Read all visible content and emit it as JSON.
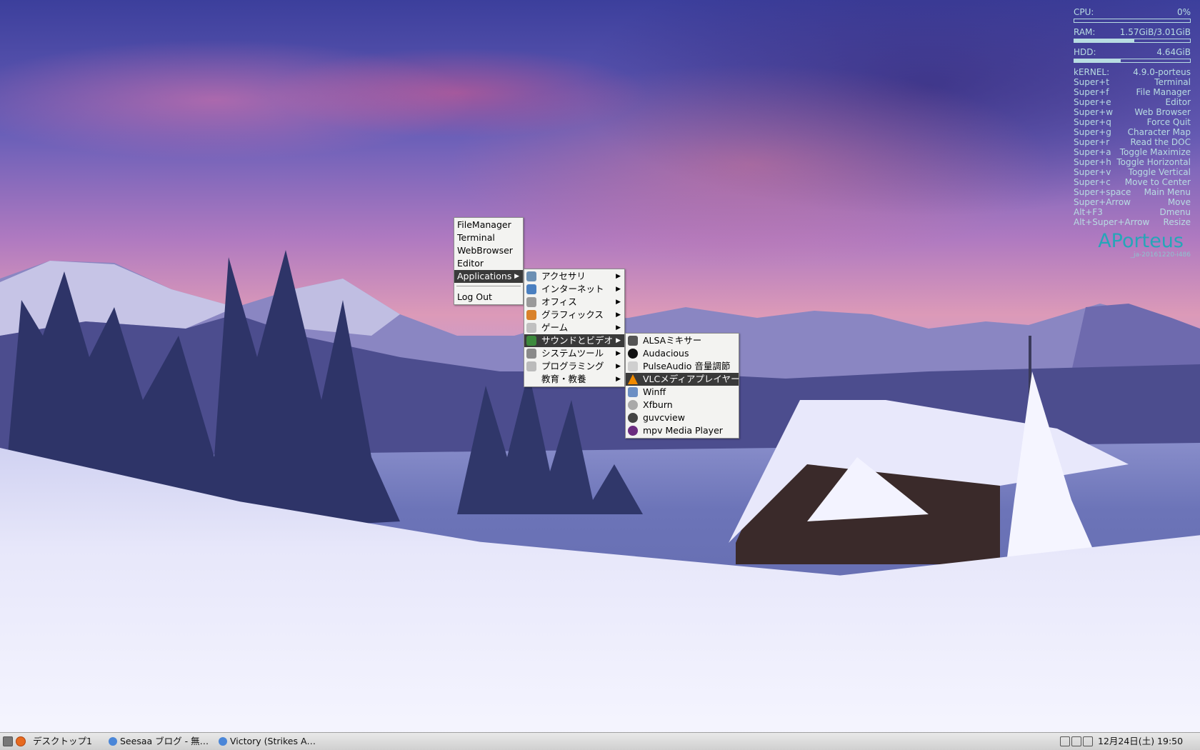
{
  "system_monitor": {
    "cpu_label": "CPU:",
    "cpu_value": "0%",
    "cpu_fraction": 0.0,
    "ram_label": "RAM:",
    "ram_value": "1.57GiB/3.01GiB",
    "ram_fraction": 0.52,
    "hdd_label": "HDD:",
    "hdd_value": "4.64GiB",
    "hdd_fraction": 0.4,
    "kernel_label": "kERNEL:",
    "kernel_value": "4.9.0-porteus",
    "shortcuts": [
      {
        "key": "Super+t",
        "action": "Terminal"
      },
      {
        "key": "Super+f",
        "action": "File Manager"
      },
      {
        "key": "Super+e",
        "action": "Editor"
      },
      {
        "key": "Super+w",
        "action": "Web Browser"
      },
      {
        "key": "Super+q",
        "action": "Force Quit"
      },
      {
        "key": "Super+g",
        "action": "Character Map"
      },
      {
        "key": "Super+r",
        "action": "Read the DOC"
      },
      {
        "key": "Super+a",
        "action": "Toggle Maximize"
      },
      {
        "key": "Super+h",
        "action": "Toggle Horizontal"
      },
      {
        "key": "Super+v",
        "action": "Toggle Vertical"
      },
      {
        "key": "Super+c",
        "action": "Move to Center"
      },
      {
        "key": "Super+space",
        "action": "Main Menu"
      },
      {
        "key": "Super+Arrow",
        "action": "Move"
      },
      {
        "key": "Alt+F3",
        "action": "Dmenu"
      },
      {
        "key": "Alt+Super+Arrow",
        "action": "Resize"
      }
    ],
    "brand": "APorteus",
    "version": "_ja-20161220-i486"
  },
  "root_menu": {
    "items": [
      "FileManager",
      "Terminal",
      "WebBrowser",
      "Editor",
      "Applications"
    ],
    "logout": "Log Out"
  },
  "applications_menu": {
    "items": [
      {
        "label": "アクセサリ",
        "icon": "accessories-icon",
        "color": "#6b8fb3"
      },
      {
        "label": "インターネット",
        "icon": "globe-icon",
        "color": "#4a7fc0"
      },
      {
        "label": "オフィス",
        "icon": "office-icon",
        "color": "#9a9a9a"
      },
      {
        "label": "グラフィックス",
        "icon": "graphics-icon",
        "color": "#d9822b"
      },
      {
        "label": "ゲーム",
        "icon": "game-icon",
        "color": "#c0c0c0"
      },
      {
        "label": "サウンドとビデオ",
        "icon": "multimedia-icon",
        "color": "#3d8a3d"
      },
      {
        "label": "システムツール",
        "icon": "gear-icon",
        "color": "#8a8a8a"
      },
      {
        "label": "プログラミング",
        "icon": "programming-icon",
        "color": "#bbbbbb"
      },
      {
        "label": "教育・教養",
        "icon": "education-icon",
        "color": "#f3f3f1"
      }
    ]
  },
  "sound_video_menu": {
    "items": [
      {
        "label": "ALSAミキサー",
        "icon": "mixer-icon",
        "color": "#555555"
      },
      {
        "label": "Audacious",
        "icon": "audacious-icon",
        "color": "#111111"
      },
      {
        "label": "PulseAudio 音量調節",
        "icon": "speaker-icon",
        "color": "#cfcfcf"
      },
      {
        "label": "VLCメディアプレイヤー",
        "icon": "vlc-cone-icon",
        "color": "#f08a00"
      },
      {
        "label": "Winff",
        "icon": "winff-icon",
        "color": "#6c8fc4"
      },
      {
        "label": "Xfburn",
        "icon": "disc-icon",
        "color": "#a9a9a9"
      },
      {
        "label": "guvcview",
        "icon": "webcam-icon",
        "color": "#444444"
      },
      {
        "label": "mpv Media Player",
        "icon": "mpv-icon",
        "color": "#6b2c80"
      }
    ]
  },
  "taskbar": {
    "desktop_label": "デスクトップ1",
    "windows": [
      "Seesaa ブログ - 無…",
      "Victory (Strikes A…"
    ],
    "clock": "12月24日(土) 19:50"
  }
}
